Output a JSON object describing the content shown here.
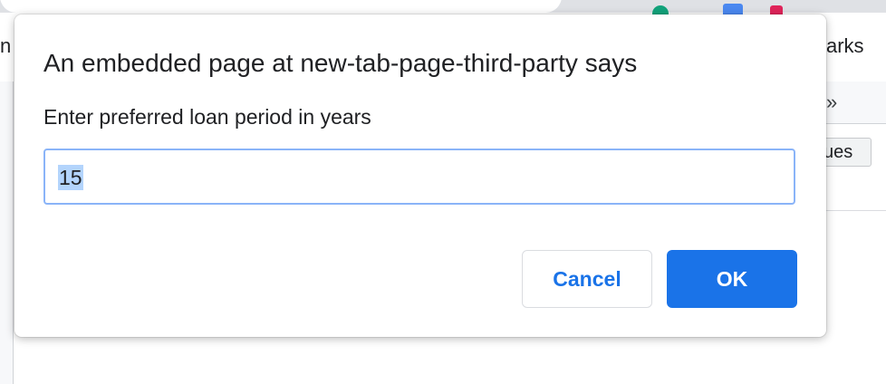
{
  "background": {
    "left_partial_text": "n",
    "bookmarks_partial_text": "arks",
    "overflow_chevrons": "»",
    "values_button_partial_text": "ues"
  },
  "dialog": {
    "title": "An embedded page at new-tab-page-third-party says",
    "message": "Enter preferred loan period in years",
    "input_value": "15",
    "cancel_label": "Cancel",
    "ok_label": "OK"
  },
  "colors": {
    "accent": "#1a73e8",
    "input_focus_border": "#8ab4f8",
    "selection": "#b3d4fc"
  }
}
